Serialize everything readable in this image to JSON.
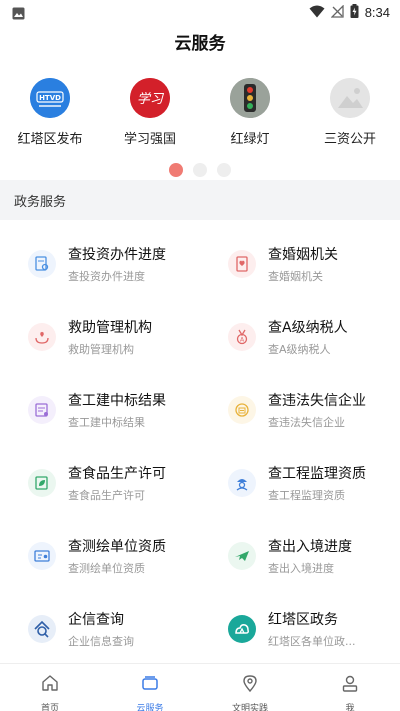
{
  "status_bar": {
    "time": "8:34"
  },
  "header": {
    "title": "云服务"
  },
  "shortcuts": [
    {
      "label": "红塔区发布",
      "logo_text": "HTVD",
      "icon": "hongta-release-logo"
    },
    {
      "label": "学习强国",
      "logo_text": "学习",
      "icon": "xuexi-qiangguo-logo"
    },
    {
      "label": "红绿灯",
      "logo_text": "",
      "icon": "traffic-light-logo"
    },
    {
      "label": "三资公开",
      "logo_text": "",
      "icon": "placeholder-image-logo"
    }
  ],
  "pager": {
    "pages": 3,
    "current": 1
  },
  "section": {
    "title": "政务服务"
  },
  "services": [
    {
      "title": "查投资办件进度",
      "subtitle": "查投资办件进度",
      "icon": "document-search-icon",
      "color": "#4a90e2"
    },
    {
      "title": "查婚姻机关",
      "subtitle": "查婚姻机关",
      "icon": "marriage-certificate-icon",
      "color": "#e06767"
    },
    {
      "title": "救助管理机构",
      "subtitle": "救助管理机构",
      "icon": "helping-hands-icon",
      "color": "#e06767"
    },
    {
      "title": "查A级纳税人",
      "subtitle": "查A级纳税人",
      "icon": "tax-medal-icon",
      "color": "#e06767"
    },
    {
      "title": "查工建中标结果",
      "subtitle": "查工建中标结果",
      "icon": "construction-bid-icon",
      "color": "#9b6ed6"
    },
    {
      "title": "查违法失信企业",
      "subtitle": "查违法失信企业",
      "icon": "dishonest-enterprise-icon",
      "color": "#e8b23a"
    },
    {
      "title": "查食品生产许可",
      "subtitle": "查食品生产许可",
      "icon": "food-license-icon",
      "color": "#33a86b"
    },
    {
      "title": "查工程监理资质",
      "subtitle": "查工程监理资质",
      "icon": "engineer-supervision-icon",
      "color": "#3f7fd9"
    },
    {
      "title": "查测绘单位资质",
      "subtitle": "查测绘单位资质",
      "icon": "surveying-qualification-icon",
      "color": "#3f7fd9"
    },
    {
      "title": "查出入境进度",
      "subtitle": "查出入境进度",
      "icon": "airplane-icon",
      "color": "#33a86b"
    },
    {
      "title": "企信查询",
      "subtitle": "企业信息查询",
      "icon": "enterprise-search-icon",
      "color": "#2f5fa8"
    },
    {
      "title": "红塔区政务",
      "subtitle": "红塔区各单位政...",
      "icon": "hongta-government-icon",
      "color": "#1aa89a"
    }
  ],
  "tabs": [
    {
      "label": "首页",
      "icon": "home-icon",
      "active": false
    },
    {
      "label": "云服务",
      "icon": "cloud-service-icon",
      "active": true
    },
    {
      "label": "文明实践",
      "icon": "location-pin-icon",
      "active": false
    },
    {
      "label": "我",
      "icon": "user-icon",
      "active": false
    }
  ]
}
